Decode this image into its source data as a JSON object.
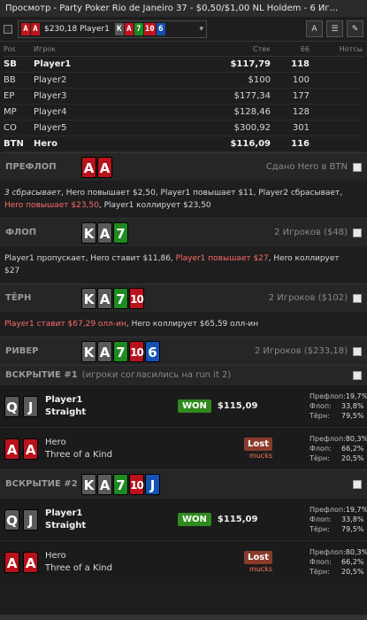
{
  "window": {
    "title": "Просмотр - Party Poker Rio de Janeiro 37 - $0,50/$1,00 NL Holdem - 6 Иг..."
  },
  "hand_selector": {
    "amount": "$230,18 Player1",
    "hole": [
      "A",
      "A"
    ],
    "board": [
      "K",
      "A",
      "7",
      "10",
      "6"
    ]
  },
  "players": {
    "headers": {
      "pos": "Pos",
      "name": "Игрок",
      "stack": "Стек",
      "hands": "66",
      "notes": "Нотсы"
    },
    "rows": [
      {
        "pos": "SB",
        "name": "Player1",
        "stack": "$117,79",
        "hands": "118",
        "bold": true
      },
      {
        "pos": "BB",
        "name": "Player2",
        "stack": "$100",
        "hands": "100"
      },
      {
        "pos": "EP",
        "name": "Player3",
        "stack": "$177,34",
        "hands": "177"
      },
      {
        "pos": "MP",
        "name": "Player4",
        "stack": "$128,46",
        "hands": "128"
      },
      {
        "pos": "CO",
        "name": "Player5",
        "stack": "$300,92",
        "hands": "301"
      },
      {
        "pos": "BTN",
        "name": "Hero",
        "stack": "$116,09",
        "hands": "116",
        "bold": true
      }
    ]
  },
  "preflop": {
    "label": "ПРЕФЛОП",
    "cards": [
      "A",
      "A"
    ],
    "right": "Сдано Hero в BTN",
    "a1": "3 сбрасывает",
    "a2": ", Hero повышает $2,50, Player1 повышает $11, Player2 сбрасывает,",
    "a3": "Hero повышает $23,50",
    "a4": ", Player1 коллирует $23,50"
  },
  "flop": {
    "label": "ФЛОП",
    "cards": [
      "K",
      "A",
      "7"
    ],
    "right": "2 Игроков ($48)",
    "a1": "Player1 пропускает, Hero ставит $11,86, ",
    "a2": "Player1 повышает $27",
    "a3": ", Hero коллирует",
    "a4": "$27"
  },
  "turn": {
    "label": "ТЁРН",
    "cards": [
      "K",
      "A",
      "7",
      "10"
    ],
    "right": "2 Игроков ($102)",
    "a1": "Player1 ставит $67,29 олл-ин",
    "a2": ", Hero коллирует $65,59 олл-ин"
  },
  "river": {
    "label": "РИВЕР",
    "cards": [
      "K",
      "A",
      "7",
      "10",
      "6"
    ],
    "right": "2 Игроков ($233,18)"
  },
  "showdown1": {
    "label": "ВСКРЫТИЕ #1",
    "note": "(игроки согласились на run it 2)",
    "p1": {
      "cards": [
        "Q",
        "J"
      ],
      "name": "Player1",
      "hand": "Straight",
      "result": "WON",
      "amount": "$115,09",
      "stats": [
        [
          "Префлоп:",
          "19,7%"
        ],
        [
          "Флоп:",
          "33,8%"
        ],
        [
          "Тёрн:",
          "79,5%"
        ]
      ]
    },
    "p2": {
      "cards": [
        "A",
        "A"
      ],
      "name": "Hero",
      "hand": "Three of a Kind",
      "result": "Lost",
      "mucks": "mucks",
      "stats": [
        [
          "Префлоп:",
          "80,3%"
        ],
        [
          "Флоп:",
          "66,2%"
        ],
        [
          "Тёрн:",
          "20,5%"
        ]
      ]
    }
  },
  "showdown2": {
    "label": "ВСКРЫТИЕ #2",
    "cards": [
      "K",
      "A",
      "7",
      "10",
      "J"
    ],
    "p1": {
      "cards": [
        "Q",
        "J"
      ],
      "name": "Player1",
      "hand": "Straight",
      "result": "WON",
      "amount": "$115,09",
      "stats": [
        [
          "Префлоп:",
          "19,7%"
        ],
        [
          "Флоп:",
          "33,8%"
        ],
        [
          "Тёрн:",
          "79,5%"
        ]
      ]
    },
    "p2": {
      "cards": [
        "A",
        "A"
      ],
      "name": "Hero",
      "hand": "Three of a Kind",
      "result": "Lost",
      "mucks": "mucks",
      "stats": [
        [
          "Префлоп:",
          "80,3%"
        ],
        [
          "Флоп:",
          "66,2%"
        ],
        [
          "Тёрн:",
          "20,5%"
        ]
      ]
    }
  },
  "colors": {
    "hearts": "#b9121b",
    "spades": "#5a5a5a",
    "clubs": "#1f8a22",
    "diamonds": "#1453b4",
    "won": "#2f8a1e",
    "lost": "#8a3b2b",
    "highlight": "#ff6a6a"
  }
}
